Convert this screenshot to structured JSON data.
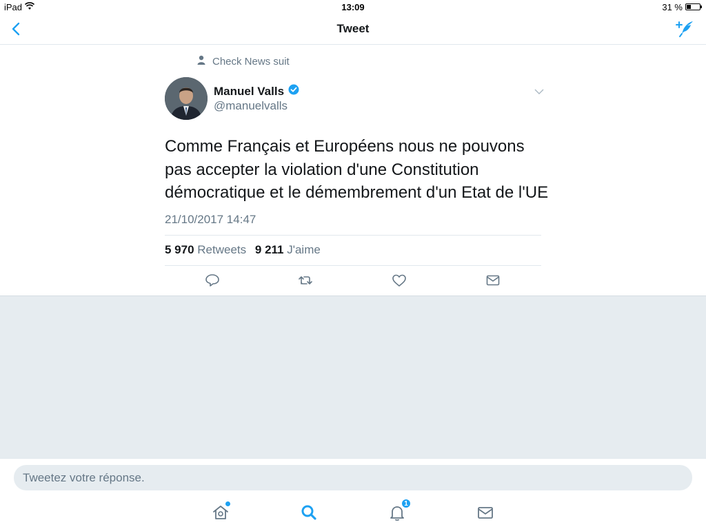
{
  "statusbar": {
    "device": "iPad",
    "time": "13:09",
    "battery_text": "31 %",
    "battery_level": 0.31
  },
  "navbar": {
    "title": "Tweet"
  },
  "tweet": {
    "social_context": "Check News suit",
    "author_name": "Manuel Valls",
    "author_handle": "@manuelvalls",
    "text": "Comme Français et Européens nous ne pouvons pas accepter la violation d'une Constitution démocratique et le démembrement d'un Etat de l'UE",
    "timestamp": "21/10/2017 14:47",
    "retweets_count": "5 970",
    "retweets_label": "Retweets",
    "likes_count": "9 211",
    "likes_label": "J'aime"
  },
  "reply": {
    "placeholder": "Tweetez votre réponse."
  },
  "tabbar": {
    "notifications_badge": "1"
  },
  "colors": {
    "accent": "#1da1f2",
    "secondary_text": "#657786",
    "background_gray": "#e6ecf0"
  }
}
